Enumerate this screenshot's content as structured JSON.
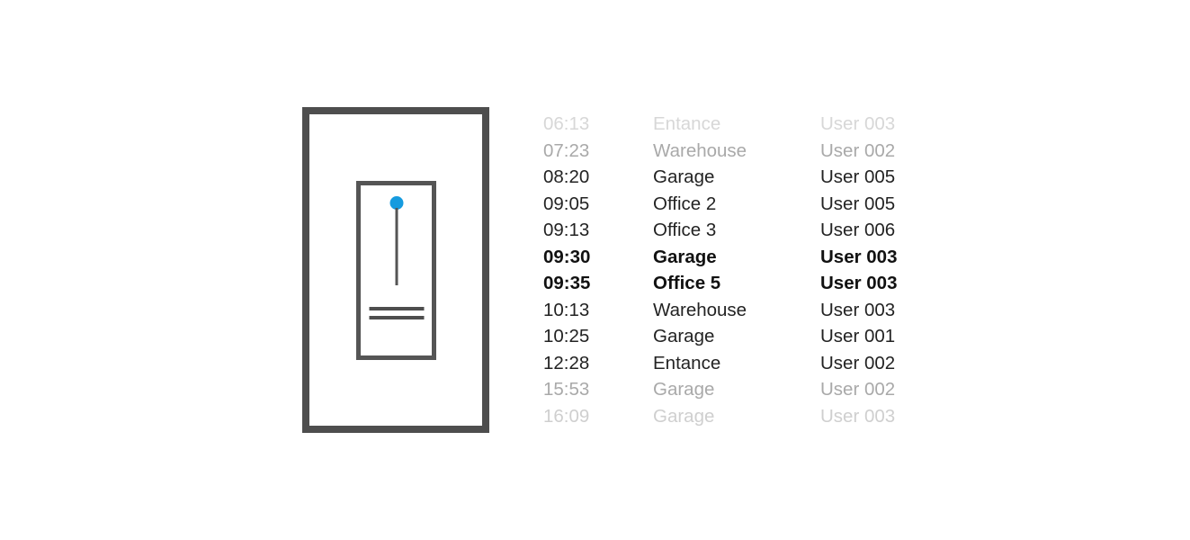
{
  "colors": {
    "background": "#ffffff",
    "device_frame": "#4e4e4e",
    "device_inner_frame": "#555555",
    "dial_accent": "#169bdf",
    "text_primary": "#232323",
    "text_emphasis": "#111111",
    "text_faded_light": "#d7d7d7",
    "text_faded_medium": "#a9a9a9"
  },
  "device": {
    "name": "access-control-panel",
    "dial": {
      "knob": "blue-dot",
      "pointer": "vertical-line"
    },
    "bars": [
      "bar-1",
      "bar-2"
    ]
  },
  "log": {
    "columns": [
      "time",
      "location",
      "user"
    ],
    "rows": [
      {
        "time": "06:13",
        "location": "Entance",
        "user": "User 003",
        "state": "fade-1"
      },
      {
        "time": "07:23",
        "location": "Warehouse",
        "user": "User 002",
        "state": "fade-2"
      },
      {
        "time": "08:20",
        "location": "Garage",
        "user": "User 005",
        "state": "normal"
      },
      {
        "time": "09:05",
        "location": "Office 2",
        "user": "User 005",
        "state": "normal"
      },
      {
        "time": "09:13",
        "location": "Office 3",
        "user": "User 006",
        "state": "normal"
      },
      {
        "time": "09:30",
        "location": "Garage",
        "user": "User 003",
        "state": "emphasis"
      },
      {
        "time": "09:35",
        "location": "Office 5",
        "user": "User 003",
        "state": "emphasis"
      },
      {
        "time": "10:13",
        "location": "Warehouse",
        "user": "User 003",
        "state": "normal"
      },
      {
        "time": "10:25",
        "location": "Garage",
        "user": "User 001",
        "state": "normal"
      },
      {
        "time": "12:28",
        "location": "Entance",
        "user": "User 002",
        "state": "normal"
      },
      {
        "time": "15:53",
        "location": "Garage",
        "user": "User 002",
        "state": "fade-2"
      },
      {
        "time": "16:09",
        "location": "Garage",
        "user": "User 003",
        "state": "fade-3"
      }
    ]
  }
}
